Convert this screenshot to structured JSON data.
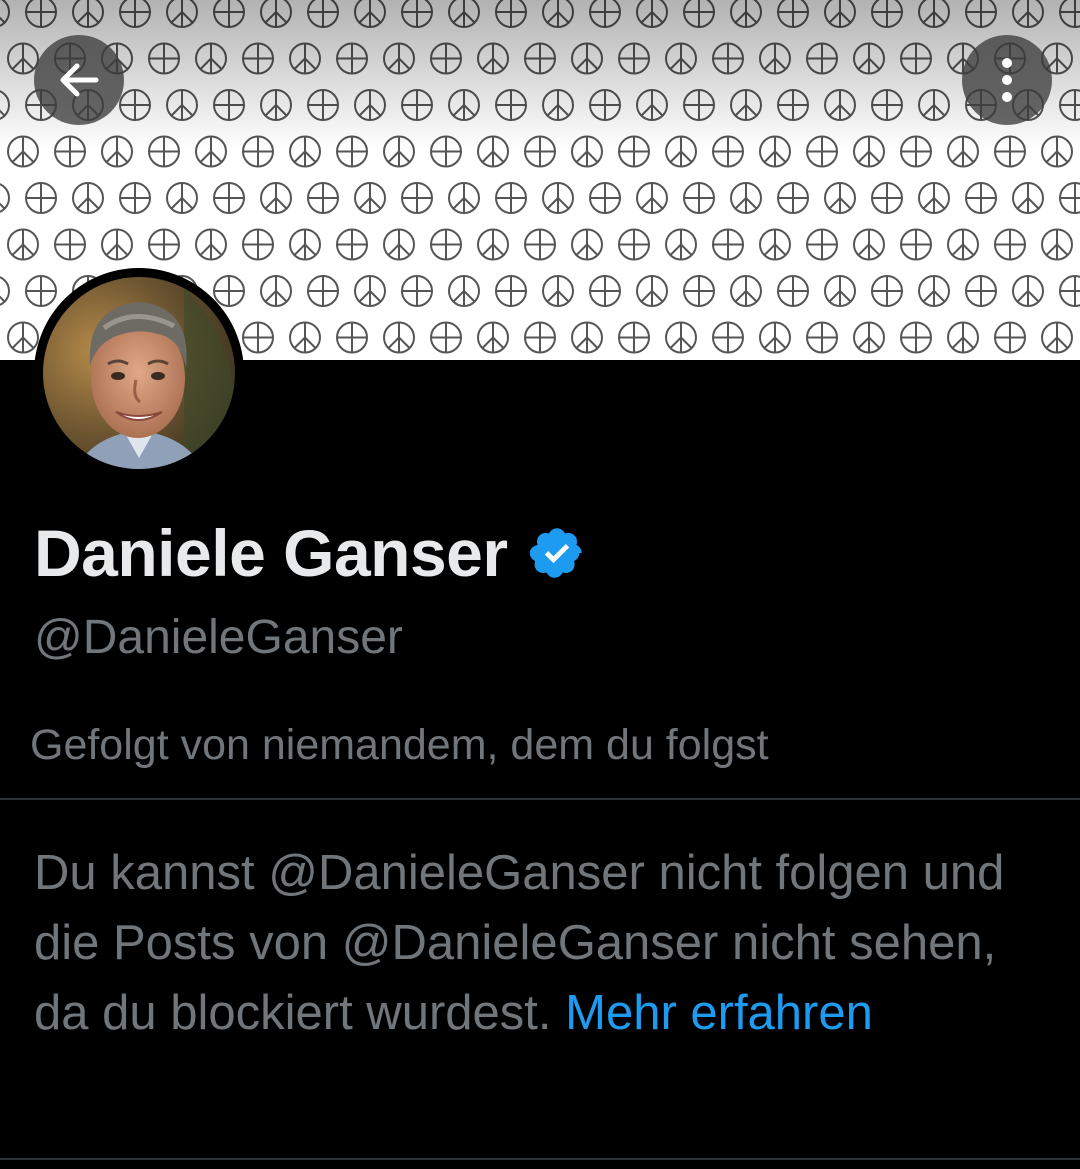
{
  "header": {
    "back_icon": "arrow-left-icon",
    "more_icon": "more-vertical-icon",
    "banner_pattern": [
      "peace-sign-icon",
      "circle-plus-icon"
    ]
  },
  "profile": {
    "display_name": "Daniele Ganser",
    "verified_badge_icon": "verified-badge-icon",
    "verified_color": "#1d9bf0",
    "handle": "@DanieleGanser",
    "followed_by": "Gefolgt von niemandem, dem du folgst"
  },
  "blocked_notice": {
    "message": "Du kannst @DanieleGanser nicht folgen und die Posts von @DanieleGanser nicht sehen, da du blockiert wurdest.",
    "link_label": "Mehr erfahren"
  },
  "colors": {
    "background": "#000000",
    "primary_text": "#e7e9ea",
    "secondary_text": "#71767b",
    "accent": "#1d9bf0",
    "divider": "#2f3336"
  }
}
